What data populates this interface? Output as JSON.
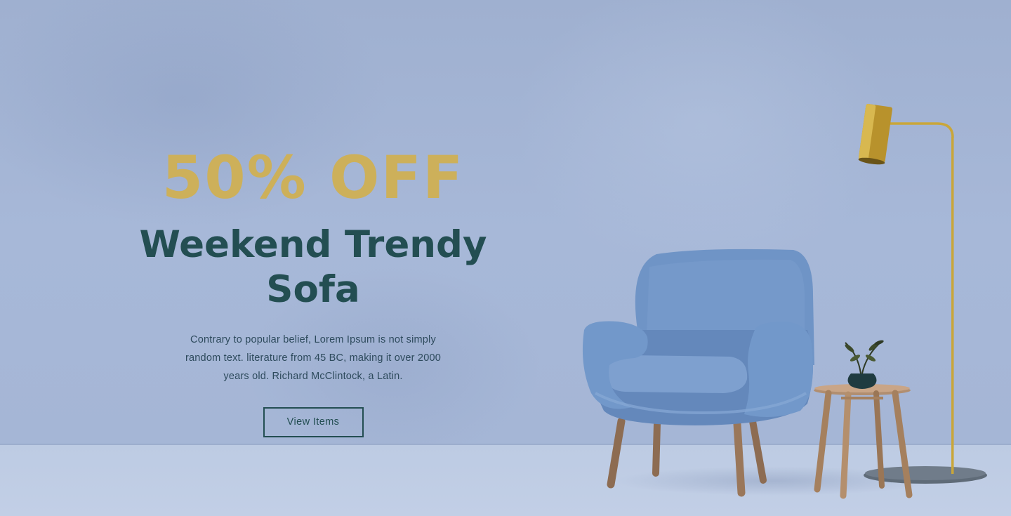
{
  "hero": {
    "offer": "50% OFF",
    "headline": "Weekend Trendy Sofa",
    "description": "Contrary to popular belief, Lorem Ipsum is not simply random text. literature from 45 BC, making it over 2000 years old. Richard McClintock, a Latin.",
    "cta_label": "View Items"
  },
  "colors": {
    "background": "#a5b6d6",
    "offer": "#cdb05a",
    "headline": "#234e52",
    "chair": "#6e93c5",
    "lamp": "#c9a63a"
  },
  "icons": [
    "armchair-image",
    "floor-lamp-image",
    "side-table-image",
    "plant-vase-image"
  ]
}
